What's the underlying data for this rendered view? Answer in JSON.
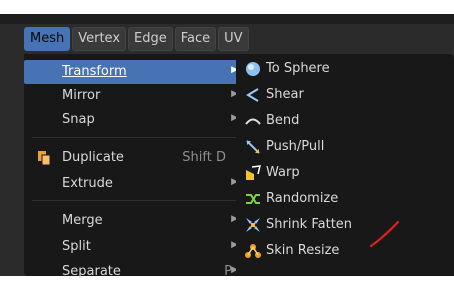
{
  "menubar": {
    "items": [
      "Mesh",
      "Vertex",
      "Edge",
      "Face",
      "UV"
    ],
    "active_index": 0
  },
  "mesh_menu": {
    "items": [
      {
        "label": "Transform",
        "shortcut": "",
        "submenu": true,
        "highlighted": true
      },
      {
        "label": "Mirror",
        "shortcut": "",
        "submenu": true,
        "highlighted": false
      },
      {
        "label": "Snap",
        "shortcut": "",
        "submenu": true,
        "highlighted": false
      },
      {
        "label": "Duplicate",
        "shortcut": "Shift D",
        "submenu": false,
        "highlighted": false,
        "icon": "duplicate-icon"
      },
      {
        "label": "Extrude",
        "shortcut": "",
        "submenu": true,
        "highlighted": false
      },
      {
        "label": "Merge",
        "shortcut": "",
        "submenu": true,
        "highlighted": false
      },
      {
        "label": "Split",
        "shortcut": "",
        "submenu": true,
        "highlighted": false
      },
      {
        "label": "Separate",
        "shortcut": "P",
        "submenu": true,
        "highlighted": false
      }
    ]
  },
  "transform_submenu": {
    "items": [
      {
        "label": "To Sphere",
        "icon": "to-sphere-icon"
      },
      {
        "label": "Shear",
        "icon": "shear-icon"
      },
      {
        "label": "Bend",
        "icon": "bend-icon"
      },
      {
        "label": "Push/Pull",
        "icon": "push-pull-icon"
      },
      {
        "label": "Warp",
        "icon": "warp-icon"
      },
      {
        "label": "Randomize",
        "icon": "randomize-icon"
      },
      {
        "label": "Shrink Fatten",
        "icon": "shrink-fatten-icon"
      },
      {
        "label": "Skin Resize",
        "icon": "skin-resize-icon"
      }
    ]
  },
  "colors": {
    "accent": "#4772b3",
    "menu_bg": "#181818",
    "annotation_red": "#e02020"
  }
}
